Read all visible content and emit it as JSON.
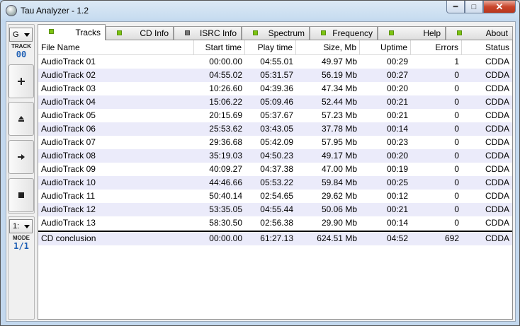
{
  "window": {
    "title": "Tau Analyzer - 1.2"
  },
  "left_panel": {
    "drive_value": "G",
    "track_label": "TRACK",
    "track_value": "00",
    "speed_value": "1:",
    "mode_label": "MODE",
    "mode_value": "1/1",
    "buttons": [
      "plus-icon",
      "eject-icon",
      "play-icon",
      "stop-icon"
    ]
  },
  "tabs": [
    {
      "label": "Tracks",
      "active": true,
      "led": "green"
    },
    {
      "label": "CD Info",
      "active": false,
      "led": "green"
    },
    {
      "label": "ISRC Info",
      "active": false,
      "led": "gray"
    },
    {
      "label": "Spectrum",
      "active": false,
      "led": "green"
    },
    {
      "label": "Frequency",
      "active": false,
      "led": "green"
    },
    {
      "label": "Help",
      "active": false,
      "led": "green"
    },
    {
      "label": "About",
      "active": false,
      "led": "green"
    }
  ],
  "table": {
    "columns": [
      "File Name",
      "Start time",
      "Play time",
      "Size, Mb",
      "Uptime",
      "Errors",
      "Status"
    ],
    "rows": [
      [
        "AudioTrack 01",
        "00:00.00",
        "04:55.01",
        "49.97 Mb",
        "00:29",
        "1",
        "CDDA"
      ],
      [
        "AudioTrack 02",
        "04:55.02",
        "05:31.57",
        "56.19 Mb",
        "00:27",
        "0",
        "CDDA"
      ],
      [
        "AudioTrack 03",
        "10:26.60",
        "04:39.36",
        "47.34 Mb",
        "00:20",
        "0",
        "CDDA"
      ],
      [
        "AudioTrack 04",
        "15:06.22",
        "05:09.46",
        "52.44 Mb",
        "00:21",
        "0",
        "CDDA"
      ],
      [
        "AudioTrack 05",
        "20:15.69",
        "05:37.67",
        "57.23 Mb",
        "00:21",
        "0",
        "CDDA"
      ],
      [
        "AudioTrack 06",
        "25:53.62",
        "03:43.05",
        "37.78 Mb",
        "00:14",
        "0",
        "CDDA"
      ],
      [
        "AudioTrack 07",
        "29:36.68",
        "05:42.09",
        "57.95 Mb",
        "00:23",
        "0",
        "CDDA"
      ],
      [
        "AudioTrack 08",
        "35:19.03",
        "04:50.23",
        "49.17 Mb",
        "00:20",
        "0",
        "CDDA"
      ],
      [
        "AudioTrack 09",
        "40:09.27",
        "04:37.38",
        "47.00 Mb",
        "00:19",
        "0",
        "CDDA"
      ],
      [
        "AudioTrack 10",
        "44:46.66",
        "05:53.22",
        "59.84 Mb",
        "00:25",
        "0",
        "CDDA"
      ],
      [
        "AudioTrack 11",
        "50:40.14",
        "02:54.65",
        "29.62 Mb",
        "00:12",
        "0",
        "CDDA"
      ],
      [
        "AudioTrack 12",
        "53:35.05",
        "04:55.44",
        "50.06 Mb",
        "00:21",
        "0",
        "CDDA"
      ],
      [
        "AudioTrack 13",
        "58:30.50",
        "02:56.38",
        "29.90 Mb",
        "00:14",
        "0",
        "CDDA"
      ]
    ],
    "summary": [
      "CD conclusion",
      "00:00.00",
      "61:27.13",
      "624.51 Mb",
      "04:52",
      "692",
      "CDDA"
    ]
  },
  "colors": {
    "alt_row": "#ebebfa",
    "led_green": "#7cc412",
    "accent_blue": "#1e5fb4"
  }
}
